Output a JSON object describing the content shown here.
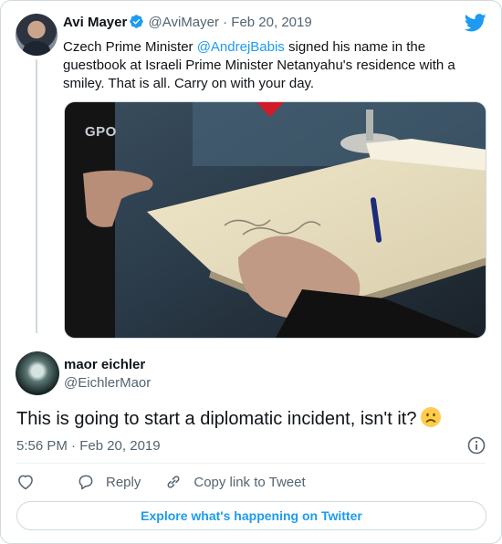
{
  "quoted_tweet": {
    "author_name": "Avi Mayer",
    "handle": "@AviMayer",
    "separator": "·",
    "date": "Feb 20, 2019",
    "text_before": "Czech Prime Minister ",
    "mention": "@AndrejBabis",
    "text_after": " signed his name in the guestbook at Israeli Prime Minister Netanyahu's residence with a smiley. That is all. Carry on with your day.",
    "image_watermark": "GPO"
  },
  "reply_tweet": {
    "author_name": "maor eichler",
    "handle": "@EichlerMaor",
    "text": "This is going to start a diplomatic incident, isn't it?",
    "timestamp": "5:56 PM · Feb 20, 2019"
  },
  "actions": {
    "reply": "Reply",
    "copy_link": "Copy link to Tweet"
  },
  "explore_button": "Explore what's happening on Twitter",
  "colors": {
    "accent": "#1d9bf0",
    "secondary_text": "#536471",
    "border": "#cfd9de"
  },
  "icons": [
    "verified-badge-icon",
    "twitter-bird-icon",
    "info-icon",
    "heart-icon",
    "reply-icon",
    "link-icon",
    "frowning-emoji-icon"
  ]
}
